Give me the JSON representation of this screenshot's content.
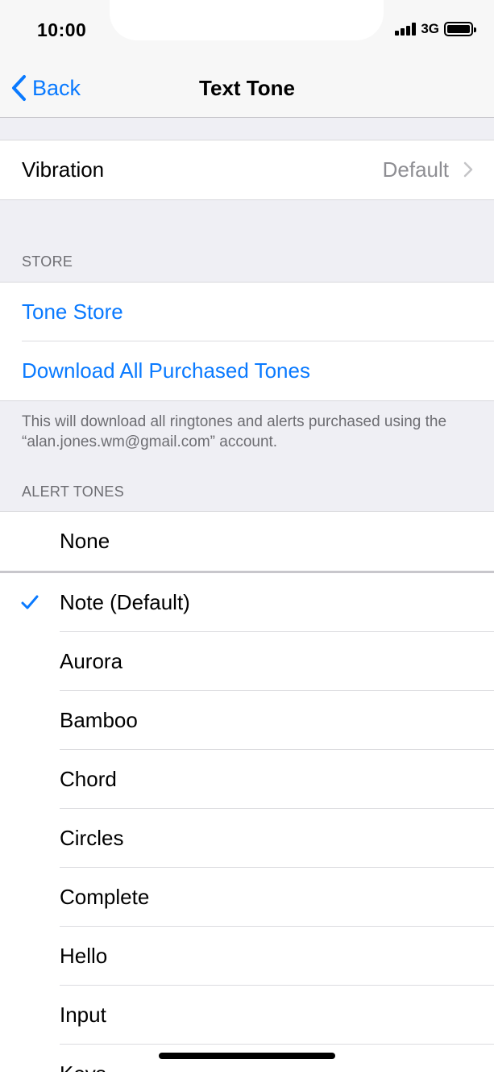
{
  "status": {
    "time": "10:00",
    "network": "3G"
  },
  "nav": {
    "back_label": "Back",
    "title": "Text Tone"
  },
  "vibration": {
    "label": "Vibration",
    "value": "Default"
  },
  "store": {
    "header": "STORE",
    "tone_store": "Tone Store",
    "download_all": "Download All Purchased Tones",
    "footer": "This will download all ringtones and alerts purchased using the “alan.jones.wm@gmail.com” account."
  },
  "alert_tones": {
    "header": "ALERT TONES",
    "none": "None",
    "items": [
      "Note (Default)",
      "Aurora",
      "Bamboo",
      "Chord",
      "Circles",
      "Complete",
      "Hello",
      "Input",
      "Keys"
    ],
    "selected_index": 0
  },
  "colors": {
    "accent": "#0a7aff",
    "background": "#efeff4"
  }
}
